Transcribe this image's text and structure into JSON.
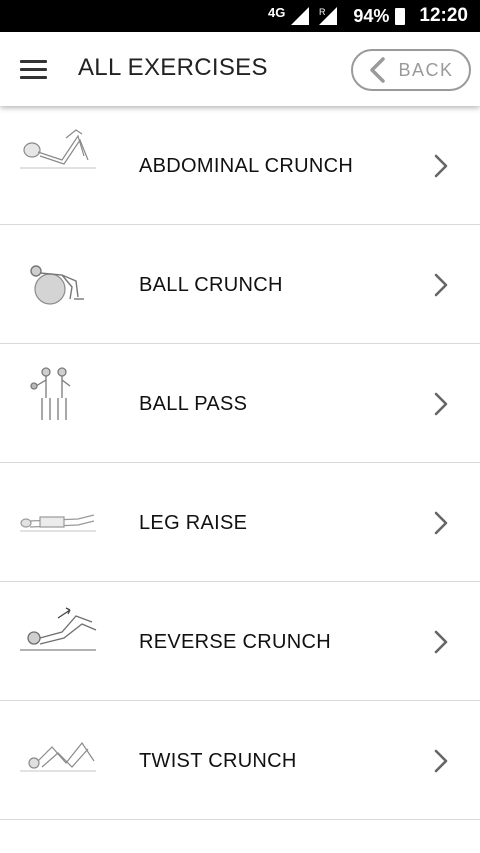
{
  "status_bar": {
    "network": "4G",
    "roaming": "R",
    "battery": "94%",
    "time": "12:20"
  },
  "app_bar": {
    "title": "ALL EXERCISES",
    "back_label": "BACK"
  },
  "exercises": [
    {
      "name": "ABDOMINAL CRUNCH",
      "icon": "abdominal-crunch-illustration"
    },
    {
      "name": "BALL CRUNCH",
      "icon": "ball-crunch-illustration"
    },
    {
      "name": "BALL PASS",
      "icon": "ball-pass-illustration"
    },
    {
      "name": "LEG RAISE",
      "icon": "leg-raise-illustration"
    },
    {
      "name": "REVERSE CRUNCH",
      "icon": "reverse-crunch-illustration"
    },
    {
      "name": "TWIST CRUNCH",
      "icon": "twist-crunch-illustration"
    }
  ]
}
